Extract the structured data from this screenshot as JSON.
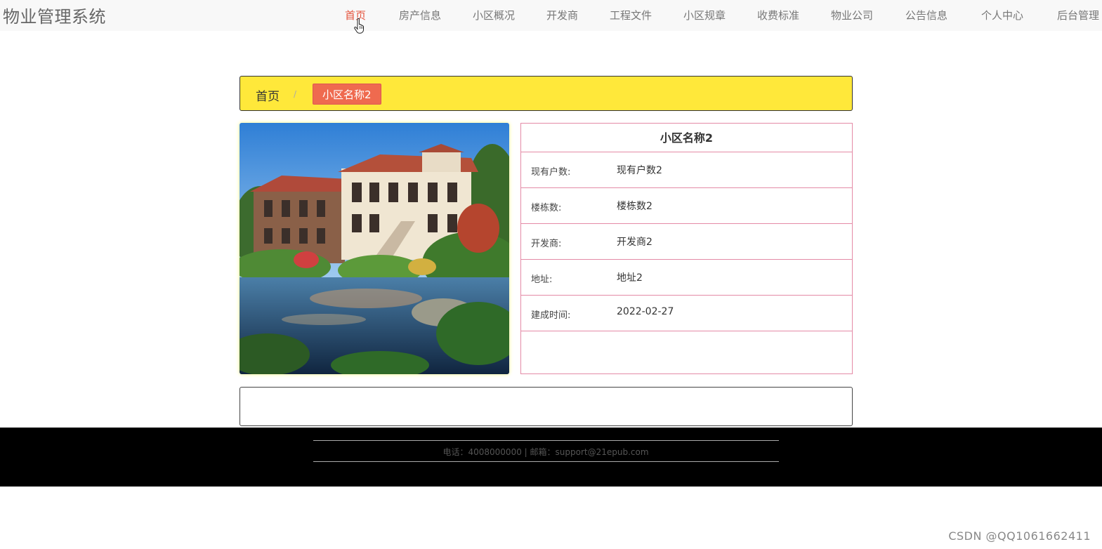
{
  "header": {
    "site_title": "物业管理系统",
    "nav": [
      {
        "label": "首页",
        "active": true
      },
      {
        "label": "房产信息"
      },
      {
        "label": "小区概况"
      },
      {
        "label": "开发商"
      },
      {
        "label": "工程文件"
      },
      {
        "label": "小区规章"
      },
      {
        "label": "收费标准"
      },
      {
        "label": "物业公司"
      },
      {
        "label": "公告信息"
      },
      {
        "label": "个人中心"
      },
      {
        "label": "后台管理"
      }
    ]
  },
  "breadcrumb": {
    "home": "首页",
    "separator": "/",
    "current": "小区名称2"
  },
  "detail": {
    "title": "小区名称2",
    "rows": [
      {
        "label": "现有户数:",
        "value": "现有户数2"
      },
      {
        "label": "楼栋数:",
        "value": "楼栋数2"
      },
      {
        "label": "开发商:",
        "value": "开发商2"
      },
      {
        "label": "地址:",
        "value": "地址2"
      },
      {
        "label": "建成时间:",
        "value": "2022-02-27"
      }
    ]
  },
  "footer": {
    "text": "电话：4008000000 | 邮箱：support@21epub.com"
  },
  "watermark": "CSDN @QQ1061662411",
  "colors": {
    "accent": "#e5533d",
    "breadcrumb_bg": "#ffe83a",
    "tag_bg": "#ef6a4f",
    "table_border": "#e48aa6",
    "footer_bg": "#000000"
  }
}
